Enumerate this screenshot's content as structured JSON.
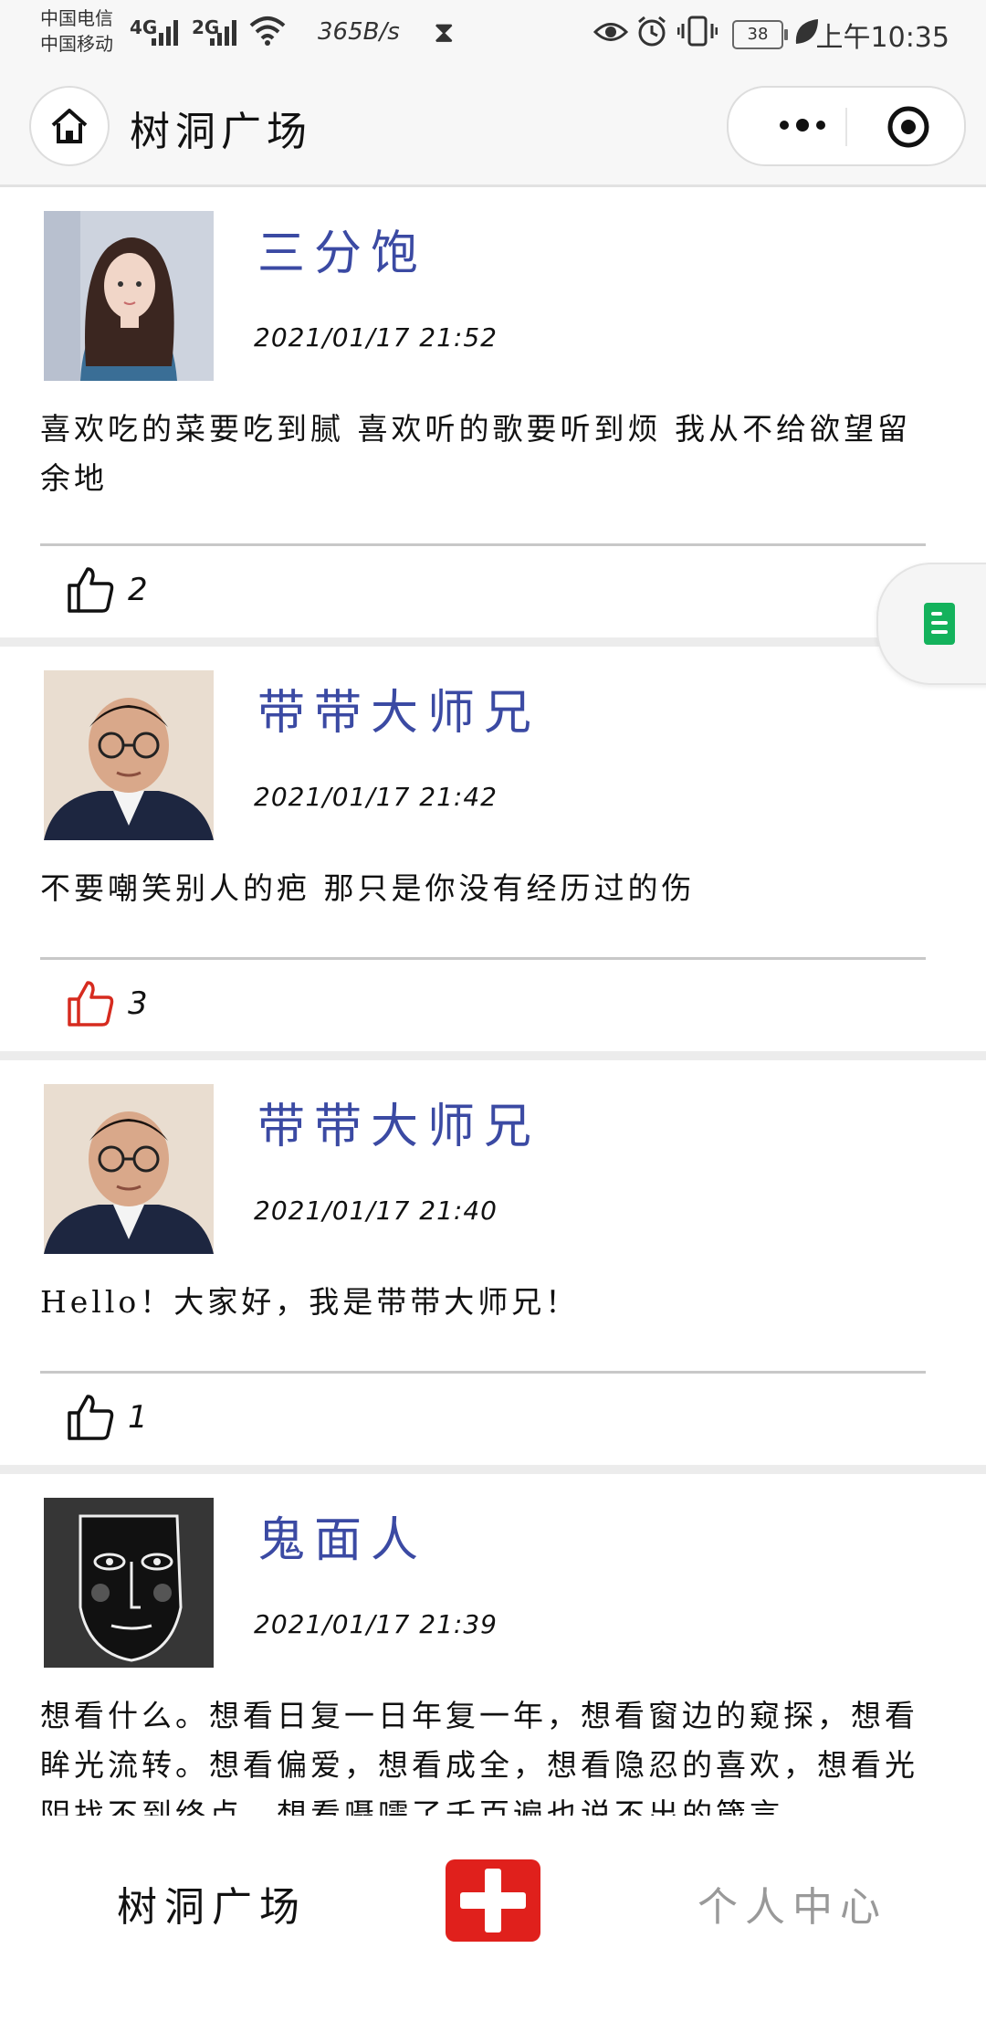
{
  "status_bar": {
    "carrier_1": "中国电信",
    "carrier_2": "中国移动",
    "net_1": "4G",
    "net_2": "2G",
    "net_speed": "365B/s",
    "battery": "38",
    "time": "上午10:35"
  },
  "header": {
    "title": "树洞广场"
  },
  "posts": [
    {
      "username": "三分饱",
      "time": "2021/01/17  21:52",
      "content": "喜欢吃的菜要吃到腻 喜欢听的歌要听到烦 我从不给欲望留余地",
      "likes": "2",
      "liked": false
    },
    {
      "username": "带带大师兄",
      "time": "2021/01/17  21:42",
      "content": "不要嘲笑别人的疤 那只是你没有经历过的伤",
      "likes": "3",
      "liked": true
    },
    {
      "username": "带带大师兄",
      "time": "2021/01/17  21:40",
      "content": "Hello！大家好，我是带带大师兄！",
      "likes": "1",
      "liked": false
    },
    {
      "username": "鬼面人",
      "time": "2021/01/17  21:39",
      "content": "想看什么。想看日复一日年复一年，想看窗边的窥探，想看眸光流转。想看偏爱，想看成全，想看隐忍的喜欢，想看光阴找不到终点，想看嗫嚅了千百遍也说不出的箴言。",
      "likes": "",
      "liked": false
    }
  ],
  "colors": {
    "username": "#3b4aa3",
    "liked": "#d62b1f",
    "add_button": "#e0201c",
    "float_icon": "#14b25c"
  },
  "tab_bar": {
    "left_label": "树洞广场",
    "right_label": "个人中心"
  }
}
